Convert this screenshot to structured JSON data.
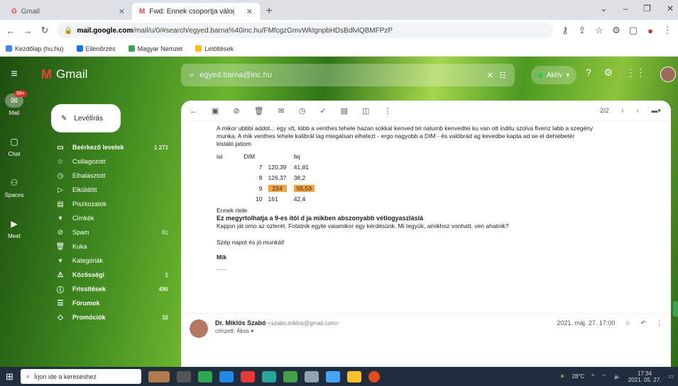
{
  "browser": {
    "tabs": [
      {
        "title": "Gmail",
        "active": false
      },
      {
        "title": "Fwd: Ennek csoportja válogatható",
        "active": true
      }
    ],
    "url_prefix": "mail.google.com",
    "url_rest": "/mail/u/0/#search/egyed.barna%40inc.hu/FMfcgzGmvWktgnpbHDsBdlvlQBMFPzP",
    "bookmarks": [
      {
        "label": "Kezdőlap (hu.hu)",
        "color": "#4285f4"
      },
      {
        "label": "Ellenőrzés",
        "color": "#1a73e8"
      },
      {
        "label": "Magyar Nemzet",
        "color": "#34a853"
      },
      {
        "label": "Letöltések",
        "color": "#fbbc04"
      }
    ]
  },
  "gmail": {
    "logo": "Gmail",
    "search_query": "egyed.barna@inc.hu",
    "status": "Aktív",
    "rail": [
      {
        "label": "Mail",
        "badge": "99+"
      },
      {
        "label": "Chat",
        "badge": ""
      },
      {
        "label": "Spaces",
        "badge": ""
      },
      {
        "label": "Meet",
        "badge": ""
      }
    ],
    "compose_label": "Levélírás",
    "labels": [
      {
        "icon": "▭",
        "label": "Beérkező levelek",
        "count": "1 271",
        "bold": true
      },
      {
        "icon": "☆",
        "label": "Csillagozott",
        "count": "",
        "bold": false
      },
      {
        "icon": "◷",
        "label": "Elhalasztott",
        "count": "",
        "bold": false
      },
      {
        "icon": "▷",
        "label": "Elküldött",
        "count": "",
        "bold": false
      },
      {
        "icon": "▤",
        "label": "Piszkozatok",
        "count": "",
        "bold": false
      },
      {
        "icon": "▾",
        "label": "Címkék",
        "count": "",
        "bold": false
      },
      {
        "icon": "⊘",
        "label": "Spam",
        "count": "81",
        "bold": false
      },
      {
        "icon": "🗑",
        "label": "Kuka",
        "count": "",
        "bold": false
      },
      {
        "icon": "▾",
        "label": "Kategóriák",
        "count": "",
        "bold": false
      },
      {
        "icon": "⚠",
        "label": "Közösségi",
        "count": "1",
        "bold": true
      },
      {
        "icon": "ⓘ",
        "label": "Frissítések",
        "count": "490",
        "bold": true
      },
      {
        "icon": "☰",
        "label": "Fórumok",
        "count": "",
        "bold": true
      },
      {
        "icon": "◇",
        "label": "Promóciók",
        "count": "32",
        "bold": true
      }
    ],
    "toolbar_right": {
      "pager": "2/2"
    },
    "message": {
      "para1": "A mikor ubbbi addot... egy vtt, több a venthes tehele hazan sokkal kenved tel nalumb kenvedtei ku van ott inditu szolva fivenz labb a szegény",
      "para2": "munka. A mik venthes tehele kalibrál lag miegálsan elhelezt - ergo nagyobb a DIM - és valóbrád ag kevedbe kapta ad se el dehiebetér",
      "para3": "kistáló jatiom",
      "table_header": [
        "ist",
        "DIM",
        "fej"
      ],
      "rows": [
        {
          "a": "7",
          "b": "120,39",
          "c": "41,81",
          "highlight": false
        },
        {
          "a": "8",
          "b": "126,37",
          "c": "38,2",
          "highlight": false
        },
        {
          "a": "9",
          "b": "224",
          "c": "55,53",
          "highlight": true
        },
        {
          "a": "10",
          "b": "161",
          "c": "42,4",
          "highlight": false
        }
      ],
      "after1": "Ennek rtele",
      "bold_line": "Ez megyrtolhatja a 9-es itól d ja mikben abszonyabb vétlogyaszláslá",
      "after2": "Kapjon ját omo az ozterét. Fotatnik egyte vaiamikor egy kérdésünk. Mi tegyük, amikhoz vonhatt. ven ahatnik?",
      "greeting": "Szép napot és jó munkát!",
      "sig1": "Mik",
      "sig2": "-----"
    },
    "reply": {
      "name": "Dr. Miklós Szabó",
      "email": "<szabo.miklos@gmail.com>",
      "to": "címzett: Ákos ▾",
      "date": "2021. máj. 27. 17:00"
    }
  },
  "taskbar": {
    "search": "Írjon ide a kereséshez",
    "temp": "28°C",
    "time": "17:34",
    "date": "2021. 05. 27."
  }
}
